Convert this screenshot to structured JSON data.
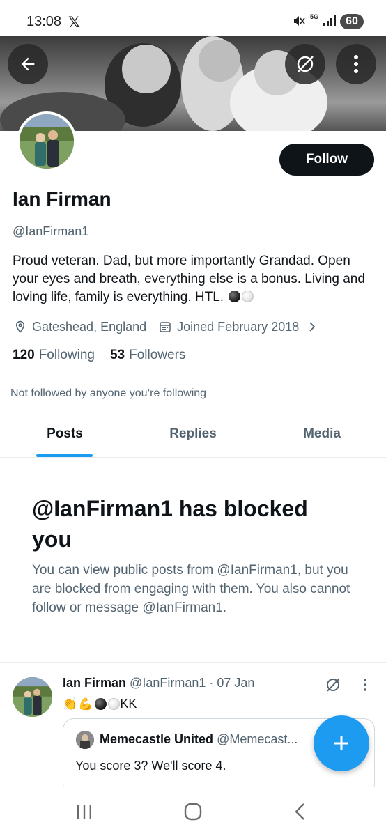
{
  "status_bar": {
    "time": "13:08",
    "x_logo": "𝕏",
    "network": "5G",
    "battery": "60"
  },
  "profile": {
    "name": "Ian Firman",
    "handle": "@IanFirman1",
    "bio": "Proud veteran. Dad, but more importantly Grandad. Open your eyes and breath, everything else is a bonus. Living and loving life, family is everything. HTL.",
    "location": "Gateshead, England",
    "joined": "Joined February 2018",
    "following_count": "120",
    "following_label": "Following",
    "followers_count": "53",
    "followers_label": "Followers",
    "not_followed_text": "Not followed by anyone you’re following",
    "follow_button": "Follow"
  },
  "tabs": [
    {
      "label": "Posts",
      "active": true
    },
    {
      "label": "Replies",
      "active": false
    },
    {
      "label": "Media",
      "active": false
    }
  ],
  "blocked": {
    "title": "@IanFirman1 has blocked you",
    "description": "You can view public posts from @IanFirman1, but you are blocked from engaging with them. You also cannot follow or message @IanFirman1."
  },
  "post": {
    "author_name": "Ian Firman",
    "author_meta": "@IanFirman1 · 07 Jan",
    "emoji_clap": "👏",
    "emoji_muscle": "💪",
    "text_suffix": "KK",
    "quote": {
      "name": "Memecastle United",
      "handle": "@Memecast...",
      "text": "You score 3? We'll score 4."
    }
  },
  "icons": {
    "back": "arrow-left-icon",
    "grok": "grok-icon",
    "more": "more-vertical-icon",
    "location": "location-pin-icon",
    "calendar": "calendar-icon",
    "chevron": "chevron-right-icon",
    "compose": "plus-icon"
  },
  "colors": {
    "accent": "#1d9bf0",
    "text_primary": "#0f1419",
    "text_secondary": "#536471",
    "follow_button_bg": "#0f1419"
  }
}
